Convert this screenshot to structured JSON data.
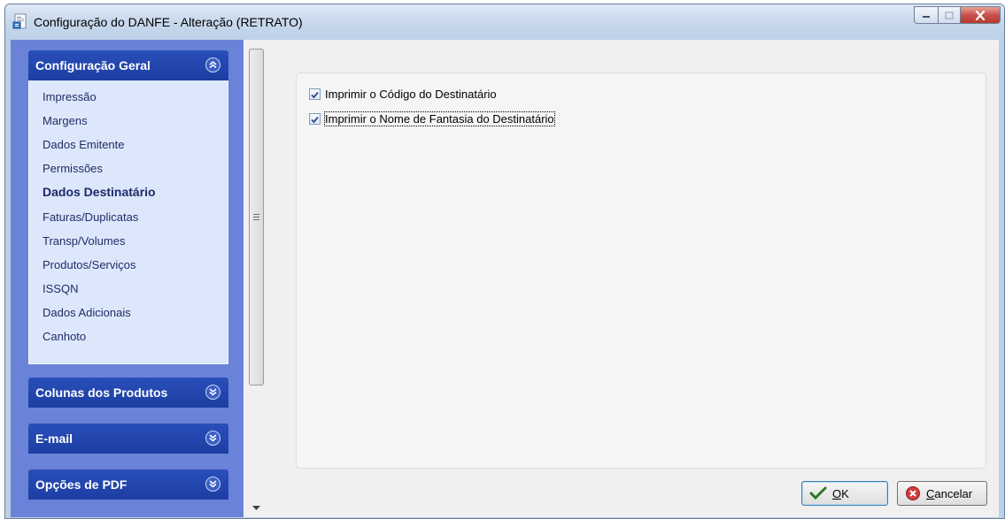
{
  "window": {
    "title": "Configuração do DANFE - Alteração  (RETRATO)"
  },
  "sidebar": {
    "groups": [
      {
        "label": "Configuração Geral",
        "expanded": true,
        "items": [
          {
            "label": "Impressão",
            "active": false
          },
          {
            "label": "Margens",
            "active": false
          },
          {
            "label": "Dados Emitente",
            "active": false
          },
          {
            "label": "Permissões",
            "active": false
          },
          {
            "label": "Dados Destinatário",
            "active": true
          },
          {
            "label": "Faturas/Duplicatas",
            "active": false
          },
          {
            "label": "Transp/Volumes",
            "active": false
          },
          {
            "label": "Produtos/Serviços",
            "active": false
          },
          {
            "label": "ISSQN",
            "active": false
          },
          {
            "label": "Dados Adicionais",
            "active": false
          },
          {
            "label": "Canhoto",
            "active": false
          }
        ]
      },
      {
        "label": "Colunas dos Produtos",
        "expanded": false
      },
      {
        "label": "E-mail",
        "expanded": false
      },
      {
        "label": "Opções de PDF",
        "expanded": false
      }
    ]
  },
  "content": {
    "options": [
      {
        "label": "Imprimir o Código do Destinatário",
        "checked": true
      },
      {
        "label": "Imprimir o Nome de Fantasia do Destinatário",
        "checked": true
      }
    ]
  },
  "buttons": {
    "ok_accel": "O",
    "ok_rest": "K",
    "cancel_accel": "C",
    "cancel_rest": "ancelar"
  },
  "colors": {
    "sidebar_bg": "#6a83d8",
    "group_header": "#1c3ea3",
    "group_body": "#dde7fb",
    "nav_text": "#1e2d67"
  },
  "icons": {
    "title": "document-icon",
    "group_collapse": "double-chevron-up-icon",
    "group_expand": "double-chevron-down-icon",
    "ok": "checkmark-icon",
    "cancel": "cancel-circle-icon"
  }
}
